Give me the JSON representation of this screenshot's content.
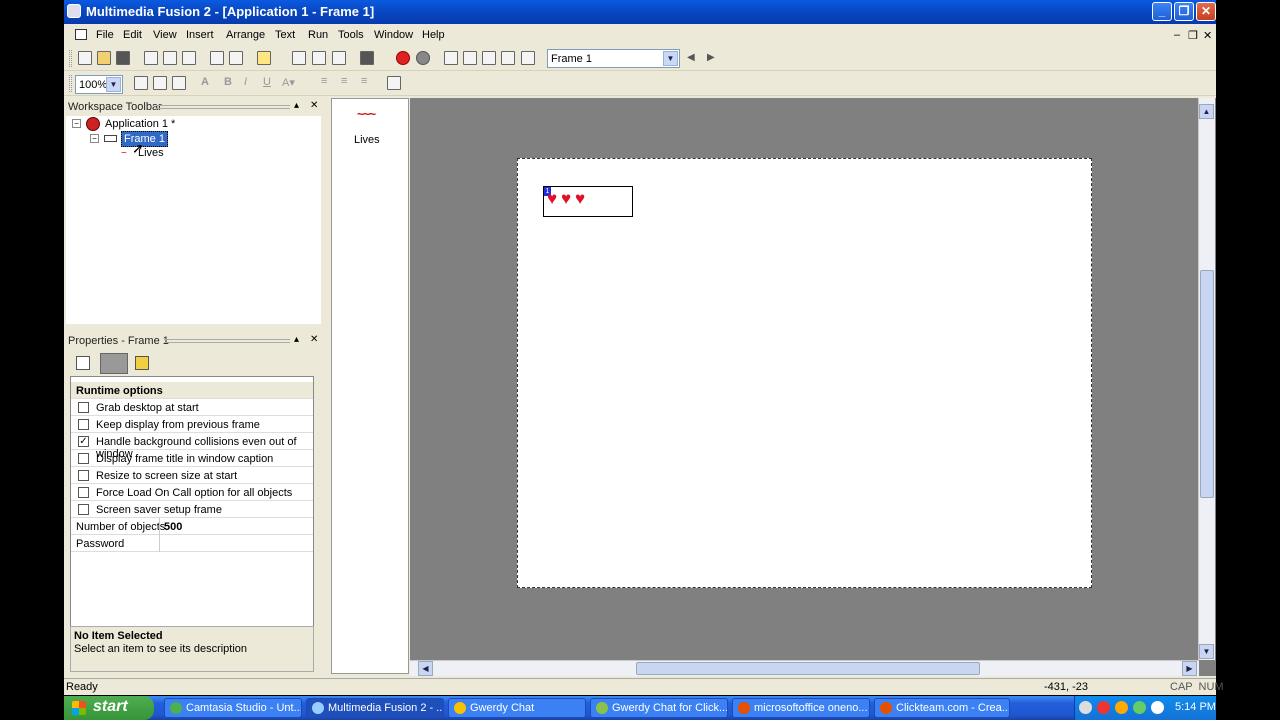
{
  "window": {
    "title": "Multimedia Fusion 2 - [Application 1 - Frame 1]"
  },
  "menu": [
    "File",
    "Edit",
    "View",
    "Insert",
    "Arrange",
    "Text",
    "Run",
    "Tools",
    "Window",
    "Help"
  ],
  "toolbar": {
    "zoom": "100%",
    "frame_select": "Frame 1"
  },
  "workspace": {
    "header": "Workspace Toolbar",
    "app": "Application 1 *",
    "frame": "Frame 1",
    "object": "Lives"
  },
  "properties": {
    "header": "Properties - Frame 1",
    "section": "Runtime options",
    "options": [
      {
        "label": "Grab desktop at start",
        "checked": false
      },
      {
        "label": "Keep display from previous frame",
        "checked": false
      },
      {
        "label": "Handle background collisions even out of window",
        "checked": true
      },
      {
        "label": "Display frame title in window caption",
        "checked": false
      },
      {
        "label": "Resize to screen size at start",
        "checked": false
      },
      {
        "label": "Force Load On Call option for all objects",
        "checked": false
      },
      {
        "label": "Screen saver setup frame",
        "checked": false
      }
    ],
    "number_label": "Number of objects",
    "number_value": "500",
    "password_label": "Password",
    "password_value": "",
    "desc_title": "No Item Selected",
    "desc_text": "Select an item to see its description"
  },
  "object_panel": {
    "label": "Lives"
  },
  "frame_editor": {
    "lives_count": 3,
    "lives_counter_digit": "1"
  },
  "status": {
    "text": "Ready",
    "coords": "-431, -23",
    "indicators": "CAP  NUM"
  },
  "taskbar": {
    "start": "start",
    "tasks": [
      "Camtasia Studio - Unt...",
      "Multimedia Fusion 2 - ...",
      "Gwerdy Chat",
      "Gwerdy Chat for Click...",
      "microsoftoffice oneno...",
      "Clickteam.com - Crea..."
    ],
    "clock": "5:14 PM"
  },
  "colors": {
    "titlebar": "#0848c4",
    "chrome": "#ece9d8",
    "editor_bg": "#808080",
    "heart": "#e0102a"
  }
}
